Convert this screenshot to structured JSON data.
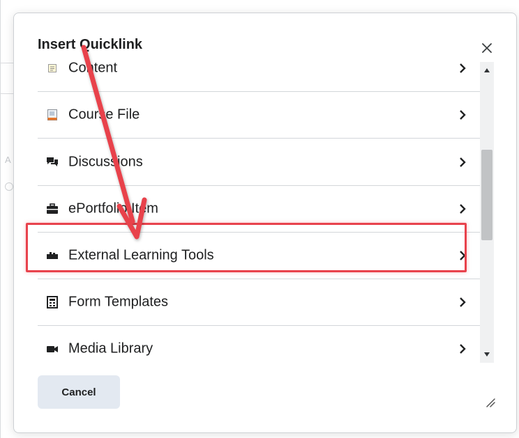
{
  "dialog": {
    "title": "Insert Quicklink",
    "close_icon": "close-icon",
    "cancel_label": "Cancel"
  },
  "list": {
    "items": [
      {
        "label": "Content",
        "icon": "content-icon"
      },
      {
        "label": "Course File",
        "icon": "course-file-icon"
      },
      {
        "label": "Discussions",
        "icon": "discussions-icon"
      },
      {
        "label": "ePortfolio Item",
        "icon": "eportfolio-icon"
      },
      {
        "label": "External Learning Tools",
        "icon": "external-tools-icon",
        "highlighted": true
      },
      {
        "label": "Form Templates",
        "icon": "form-templates-icon"
      },
      {
        "label": "Media Library",
        "icon": "media-library-icon"
      }
    ]
  },
  "annotation": {
    "highlight_color": "#e8424c",
    "arrow_color": "#e8424c"
  }
}
